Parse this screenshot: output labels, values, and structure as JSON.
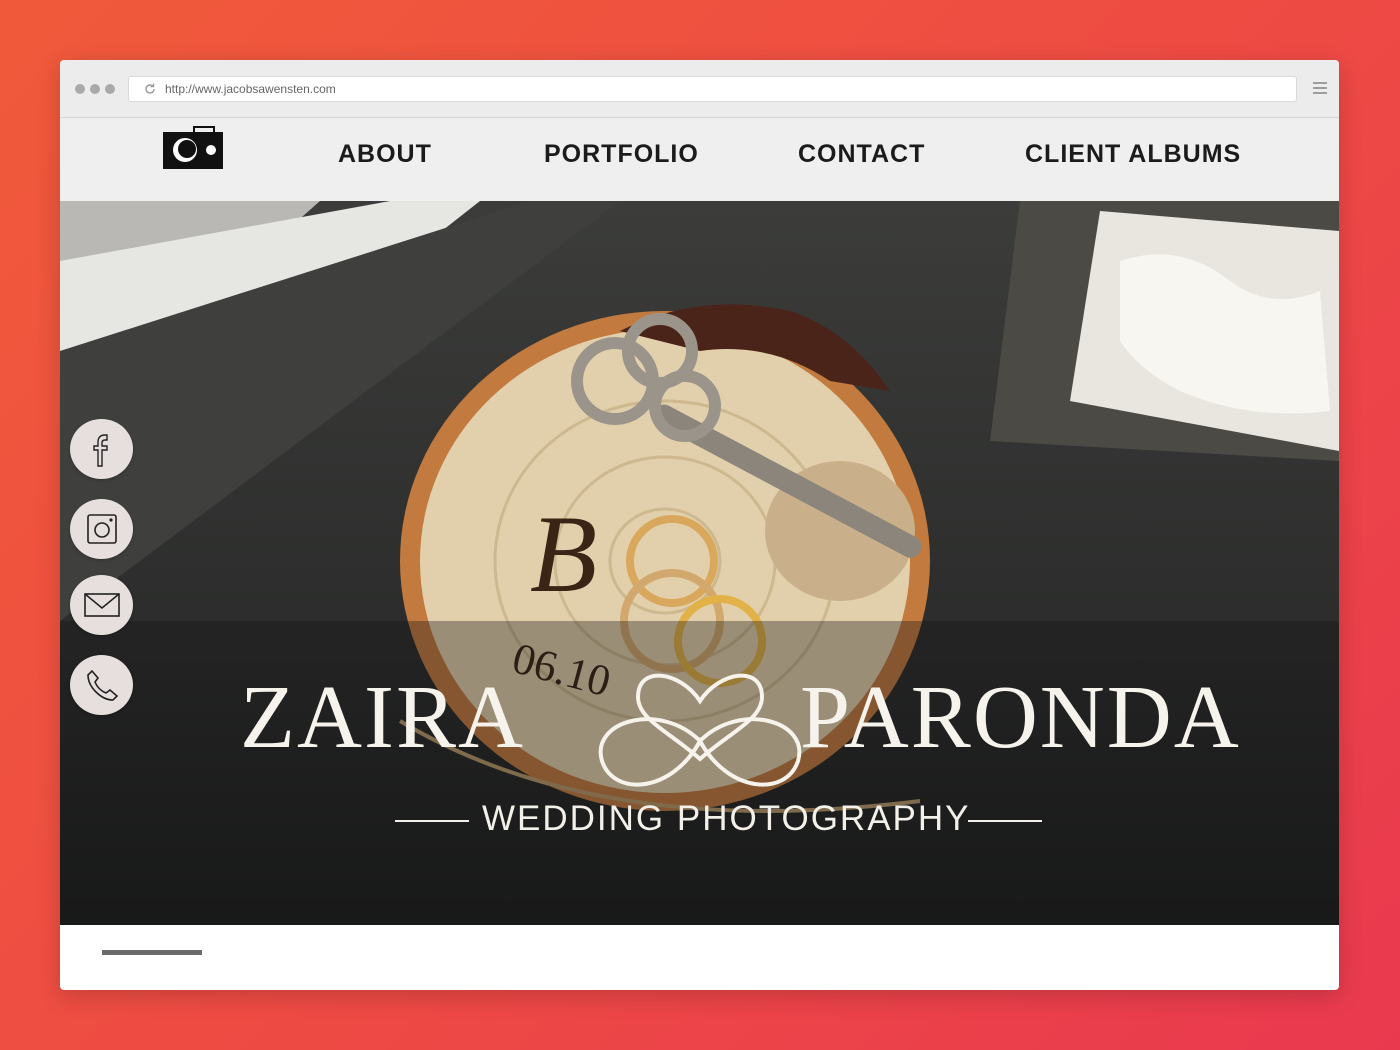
{
  "browser": {
    "url": "http://www.jacobsawensten.com"
  },
  "nav": {
    "items": [
      {
        "label": "ABOUT"
      },
      {
        "label": "PORTFOLIO"
      },
      {
        "label": "CONTACT"
      },
      {
        "label": "CLIENT ALBUMS"
      }
    ]
  },
  "hero": {
    "name_left": "ZAIRA",
    "name_right": "PARONDA",
    "subtitle": "WEDDING PHOTOGRAPHY"
  },
  "social": [
    "facebook-icon",
    "instagram-icon",
    "mail-icon",
    "phone-icon"
  ],
  "colors": {
    "background_start": "#f05a3a",
    "background_end": "#e9394f",
    "nav_background": "#efefef",
    "hero_text": "#f6f2ec"
  }
}
